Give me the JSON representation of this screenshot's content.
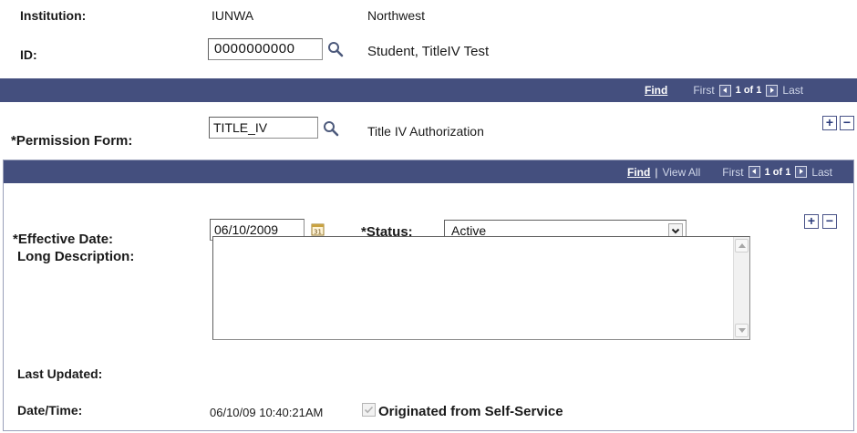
{
  "header": {
    "institution_label": "Institution:",
    "institution_code": "IUNWA",
    "institution_name": "Northwest",
    "id_label": "ID:",
    "id_value": "0000000000",
    "student_name": "Student, TitleIV Test"
  },
  "outer_nav": {
    "find": "Find",
    "first": "First",
    "count": "1 of 1",
    "last": "Last"
  },
  "permission": {
    "label": "*Permission Form:",
    "value": "TITLE_IV",
    "description": "Title IV Authorization"
  },
  "inner_nav": {
    "find": "Find",
    "separator": "|",
    "view_all": "View All",
    "first": "First",
    "count": "1 of 1",
    "last": "Last"
  },
  "detail": {
    "effective_date_label": "*Effective Date:",
    "effective_date_value": "06/10/2009",
    "status_label": "*Status:",
    "status_value": "Active",
    "long_description_label": "Long Description:",
    "long_description_value": "",
    "last_updated_label": "Last Updated:",
    "datetime_label": "Date/Time:",
    "datetime_value": "06/10/09 10:40:21AM",
    "self_service_label": "Originated from Self-Service"
  },
  "buttons": {
    "add": "+",
    "remove": "−"
  },
  "colors": {
    "header_bar": "#444f7e",
    "panel_border": "#9aa0ba"
  },
  "icons": [
    "search-icon",
    "calendar-icon",
    "dropdown-arrow-icon",
    "add-row-icon",
    "delete-row-icon",
    "prev-arrow-icon",
    "next-arrow-icon"
  ]
}
